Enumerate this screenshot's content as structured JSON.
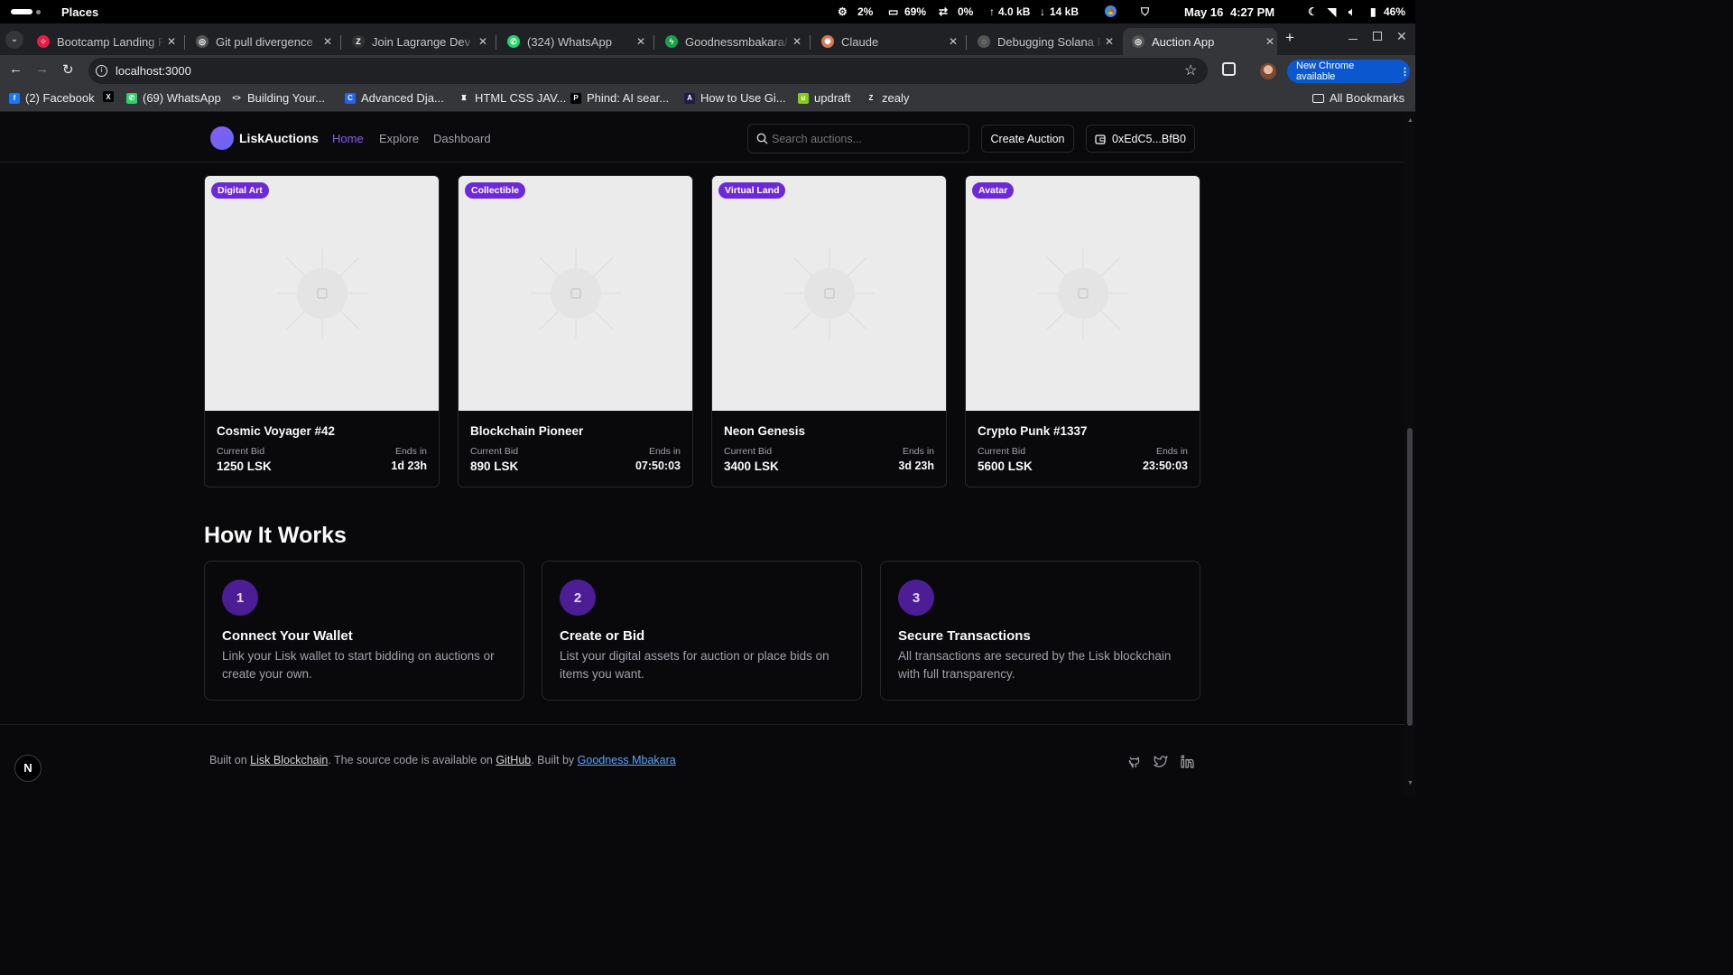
{
  "os": {
    "workspace": "Places",
    "cpu": "2%",
    "mem": "69%",
    "swap": "0%",
    "up": "4.0 kB",
    "down": "14 kB",
    "date": "May 16",
    "time": "4:27 PM",
    "battery": "46%"
  },
  "tabs": [
    {
      "title": "Bootcamp Landing P",
      "color": "#e11d48",
      "glyph": "⁘"
    },
    {
      "title": "Git pull divergence",
      "color": "#555",
      "glyph": "◎"
    },
    {
      "title": "Join Lagrange Dev |",
      "color": "#333",
      "glyph": "Z"
    },
    {
      "title": "(324) WhatsApp",
      "color": "#25d366",
      "glyph": "✆"
    },
    {
      "title": "Goodnessmbakara/",
      "color": "#16a34a",
      "glyph": "ϟ"
    },
    {
      "title": "Claude",
      "color": "#d97757",
      "glyph": "✺"
    },
    {
      "title": "Debugging Solana P",
      "color": "#555",
      "glyph": "◌"
    },
    {
      "title": "Auction App",
      "color": "#555",
      "glyph": "◎"
    }
  ],
  "new_tab_glyph": "+",
  "url": "localhost:3000",
  "chrome_update": "New Chrome available",
  "bookmarks": [
    {
      "label": "(2) Facebook",
      "color": "#1877f2",
      "glyph": "f"
    },
    {
      "label": "",
      "color": "#000",
      "glyph": "X"
    },
    {
      "label": "(69) WhatsApp",
      "color": "#25d366",
      "glyph": "✆"
    },
    {
      "label": "Building Your...",
      "color": "#35363a",
      "glyph": "<>"
    },
    {
      "label": "Advanced Dja...",
      "color": "#2563eb",
      "glyph": "C"
    },
    {
      "label": "HTML CSS JAV...",
      "color": "#35363a",
      "glyph": "♜"
    },
    {
      "label": "Phind: AI sear...",
      "color": "#000",
      "glyph": "P"
    },
    {
      "label": "How to Use Gi...",
      "color": "#1e1b4b",
      "glyph": "A"
    },
    {
      "label": "updraft",
      "color": "#84cc16",
      "glyph": "u"
    },
    {
      "label": "zealy",
      "color": "#333",
      "glyph": "Z"
    }
  ],
  "all_bookmarks": "All Bookmarks",
  "app": {
    "brand": "LiskAuctions",
    "nav": [
      "Home",
      "Explore",
      "Dashboard"
    ],
    "search_placeholder": "Search auctions...",
    "create_label": "Create Auction",
    "wallet": "0xEdC5...BfB0"
  },
  "auctions": [
    {
      "badge": "Digital Art",
      "name": "Cosmic Voyager #42",
      "bid_label": "Current Bid",
      "bid": "1250 LSK",
      "ends_label": "Ends in",
      "ends": "1d 23h"
    },
    {
      "badge": "Collectible",
      "name": "Blockchain Pioneer",
      "bid_label": "Current Bid",
      "bid": "890 LSK",
      "ends_label": "Ends in",
      "ends": "07:50:03"
    },
    {
      "badge": "Virtual Land",
      "name": "Neon Genesis",
      "bid_label": "Current Bid",
      "bid": "3400 LSK",
      "ends_label": "Ends in",
      "ends": "3d 23h"
    },
    {
      "badge": "Avatar",
      "name": "Crypto Punk #1337",
      "bid_label": "Current Bid",
      "bid": "5600 LSK",
      "ends_label": "Ends in",
      "ends": "23:50:03"
    }
  ],
  "how": {
    "heading": "How It Works",
    "steps": [
      {
        "num": "1",
        "title": "Connect Your Wallet",
        "desc": "Link your Lisk wallet to start bidding on auctions or create your own."
      },
      {
        "num": "2",
        "title": "Create or Bid",
        "desc": "List your digital assets for auction or place bids on items you want."
      },
      {
        "num": "3",
        "title": "Secure Transactions",
        "desc": "All transactions are secured by the Lisk blockchain with full transparency."
      }
    ]
  },
  "footer": {
    "built_on": "Built on ",
    "lisk_link": "Lisk Blockchain",
    "source_text": ". The source code is available on ",
    "github_link": "GitHub",
    "built_by": ". Built by ",
    "author_link": "Goodness Mbakara"
  },
  "next_badge": "N"
}
